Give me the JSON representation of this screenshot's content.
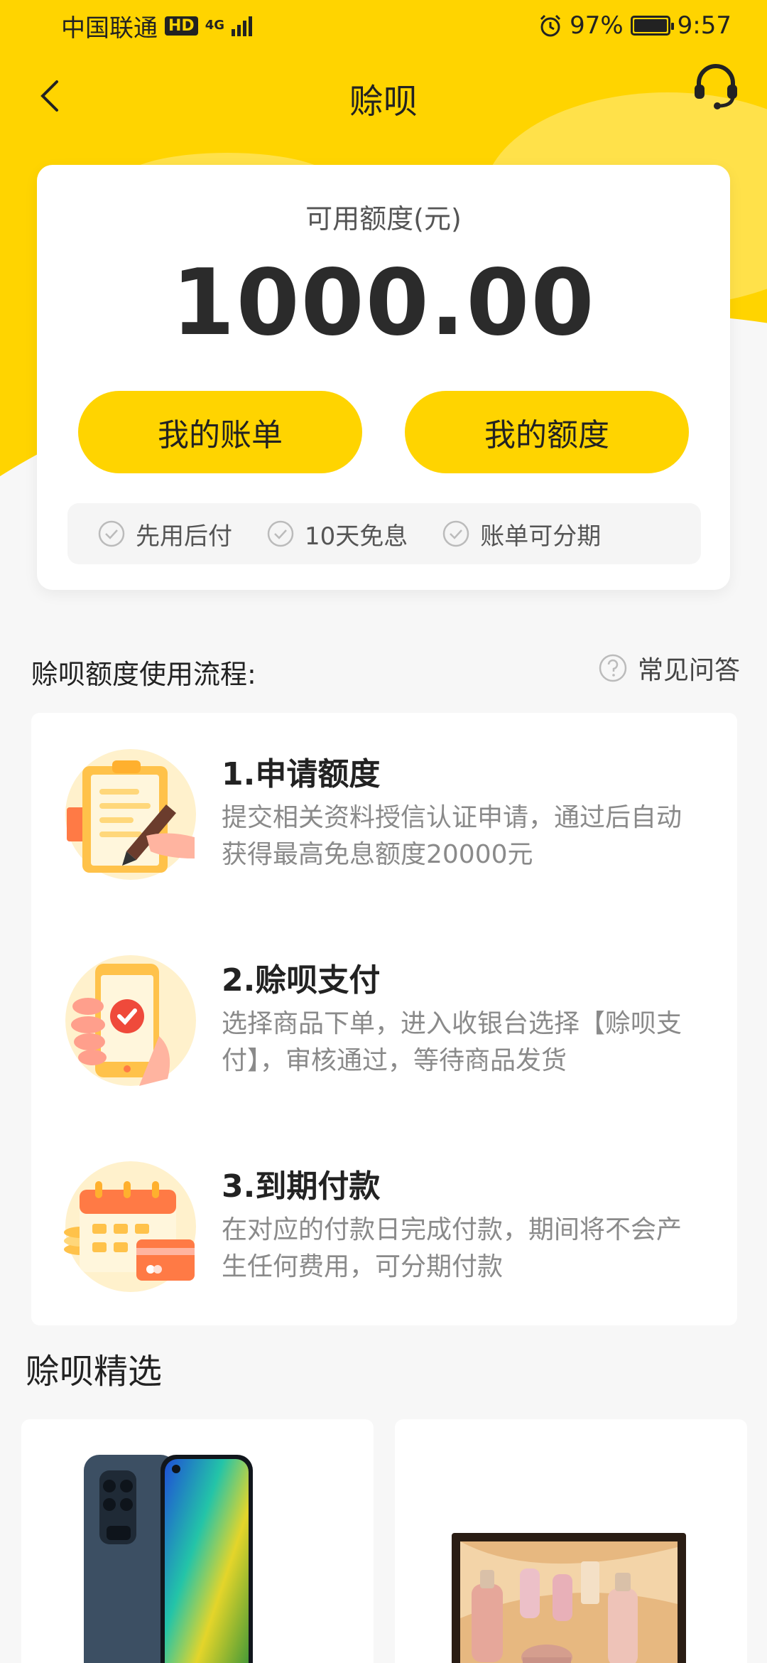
{
  "status_bar": {
    "carrier": "中国联通",
    "hd": "HD",
    "network": "4G",
    "battery": "97%",
    "time": "9:57"
  },
  "nav": {
    "title": "赊呗"
  },
  "credit": {
    "label": "可用额度(元)",
    "amount": "1000.00",
    "bill_button": "我的账单",
    "quota_button": "我的额度",
    "features": [
      "先用后付",
      "10天免息",
      "账单可分期"
    ]
  },
  "process": {
    "title": "赊呗额度使用流程:",
    "faq": "常见问答",
    "steps": [
      {
        "title": "1.申请额度",
        "desc": "提交相关资料授信认证申请，通过后自动获得最高免息额度20000元",
        "icon": "clipboard-pen-icon"
      },
      {
        "title": "2.赊呗支付",
        "desc": "选择商品下单，进入收银台选择【赊呗支付】，审核通过，等待商品发货",
        "icon": "phone-payment-icon"
      },
      {
        "title": "3.到期付款",
        "desc": "在对应的付款日完成付款，期间将不会产生任何费用，可分期付款",
        "icon": "calendar-card-icon"
      }
    ]
  },
  "selection": {
    "title": "赊呗精选"
  },
  "colors": {
    "brand_yellow": "#ffd400",
    "text_dark": "#222222",
    "text_gray": "#8a8a8a"
  }
}
